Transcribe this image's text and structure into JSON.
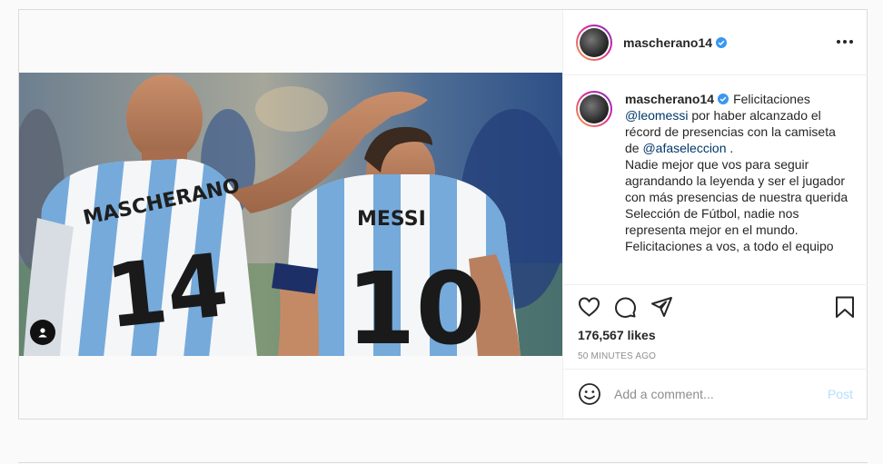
{
  "post": {
    "username": "mascherano14",
    "verified": true,
    "photo_text": {
      "left_name": "MASCHERANO",
      "left_number": "14",
      "right_name": "MESSI",
      "right_number": "10"
    },
    "caption": {
      "username": "mascherano14",
      "line1_prefix": "Felicitaciones",
      "mention1": "@leomessi",
      "line2": " por haber alcanzado el récord de presencias con la camiseta de ",
      "mention2": "@afaseleccion",
      "line3": " .",
      "para2": "Nadie mejor que vos para seguir agrandando la leyenda y ser el jugador con más presencias de nuestra querida Selección de Fútbol, nadie nos representa mejor en el mundo.",
      "para3": "Felicitaciones a vos, a todo el equipo"
    },
    "likes": "176,567 likes",
    "time": "50 MINUTES AGO",
    "comment_placeholder": "Add a comment...",
    "post_label": "Post"
  },
  "icons": {
    "verified": "verified-badge-icon",
    "more": "more-options-icon",
    "like": "heart-icon",
    "comment": "comment-icon",
    "share": "share-icon",
    "save": "bookmark-icon",
    "emoji": "emoji-icon",
    "tag": "user-tag-icon"
  },
  "colors": {
    "verified": "#3897f0",
    "mention": "#00376b",
    "post_disabled": "#b2dffc",
    "jersey_blue": "#75aadb"
  }
}
